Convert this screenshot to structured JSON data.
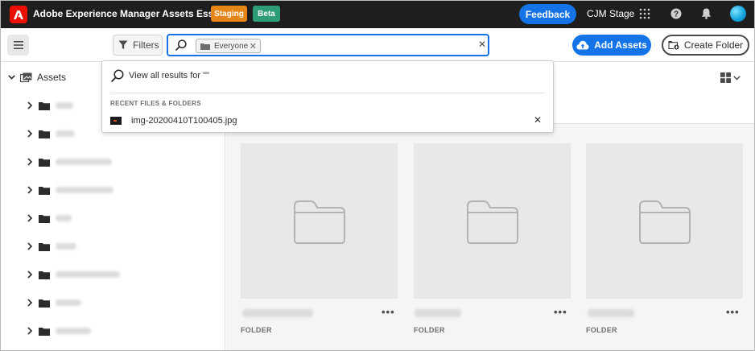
{
  "header": {
    "app_title": "Adobe Experience Manager Assets Essentials",
    "badges": [
      "Staging",
      "Beta"
    ],
    "feedback_label": "Feedback",
    "org_name": "CJM Stage",
    "icons": [
      "apps-grid-icon",
      "help-icon",
      "notifications-bell-icon",
      "user-avatar"
    ]
  },
  "toolbar": {
    "filters_label": "Filters",
    "search_tag": "Everyone",
    "search_value": "",
    "add_assets_label": "Add Assets",
    "create_folder_label": "Create Folder"
  },
  "search_dropdown": {
    "view_all_label": "View all results for \"\"",
    "recent_heading": "RECENT FILES & FOLDERS",
    "recent_items": [
      {
        "name": "img-20200410T100405.jpg"
      }
    ]
  },
  "sidebar": {
    "root_label": "Assets",
    "folders_count_visible": 10
  },
  "main": {
    "cards": [
      {
        "type": "FOLDER"
      },
      {
        "type": "FOLDER"
      },
      {
        "type": "FOLDER"
      }
    ]
  },
  "colors": {
    "topbar": "#1e1e1e",
    "accent": "#1473e6",
    "staging": "#e68619",
    "beta": "#2d9d78",
    "adobe_red": "#eb1000"
  }
}
